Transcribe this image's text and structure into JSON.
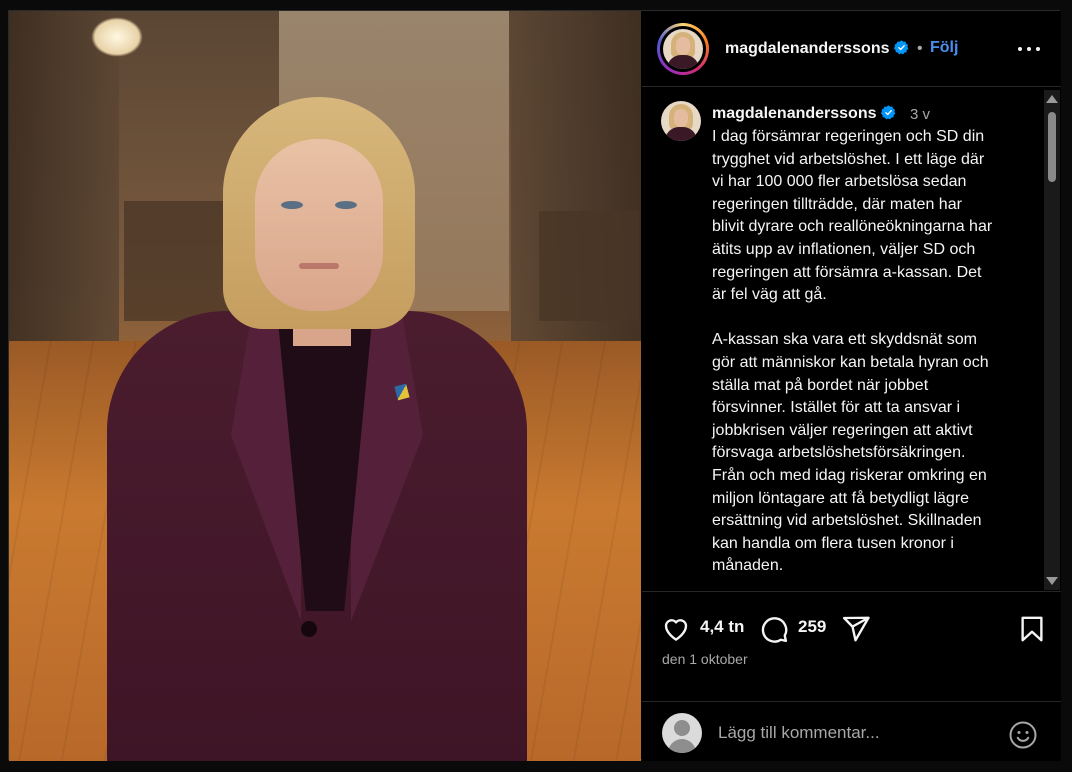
{
  "post": {
    "username": "magdalenanderssons",
    "follow_label": "Följ",
    "separator": "•",
    "caption": {
      "username": "magdalenanderssons",
      "time_ago": "3 v",
      "lines_p1": [
        "I dag försämrar regeringen och SD din",
        "trygghet vid arbetslöshet. I ett läge där",
        "vi har 100 000 fler arbetslösa sedan",
        "regeringen tillträdde, där maten har",
        "blivit dyrare och reallöneökningarna har",
        "ätits upp av inflationen, väljer SD och",
        "regeringen att försämra a-kassan. Det",
        "är fel väg att gå."
      ],
      "lines_p2": [
        "A-kassan ska vara ett skyddsnät som",
        "gör att människor kan betala hyran och",
        "ställa mat på bordet när jobbet",
        "försvinner. Istället för att ta ansvar i",
        "jobbkrisen väljer regeringen att aktivt",
        "försvaga arbetslöshetsförsäkringen.",
        "Från och med idag riskerar omkring en",
        "miljon löntagare att få betydligt lägre",
        "ersättning vid arbetslöshet. Skillnaden",
        "kan handla om flera tusen kronor i",
        "månaden."
      ]
    },
    "likes": "4,4 tn",
    "comments": "259",
    "date": "den 1 oktober",
    "comment_placeholder": "Lägg till kommentar..."
  },
  "icons": {
    "verified": "verified-badge-icon",
    "more": "more-options-icon",
    "like": "heart-icon",
    "comment": "comment-bubble-icon",
    "share": "paper-plane-icon",
    "save": "bookmark-icon",
    "emoji": "emoji-smiley-icon"
  },
  "colors": {
    "background": "#000000",
    "text": "#f5f5f5",
    "secondary_text": "#a8a8a8",
    "link_blue": "#4a8ff0",
    "verified_blue": "#0095f6",
    "divider": "#262626"
  }
}
